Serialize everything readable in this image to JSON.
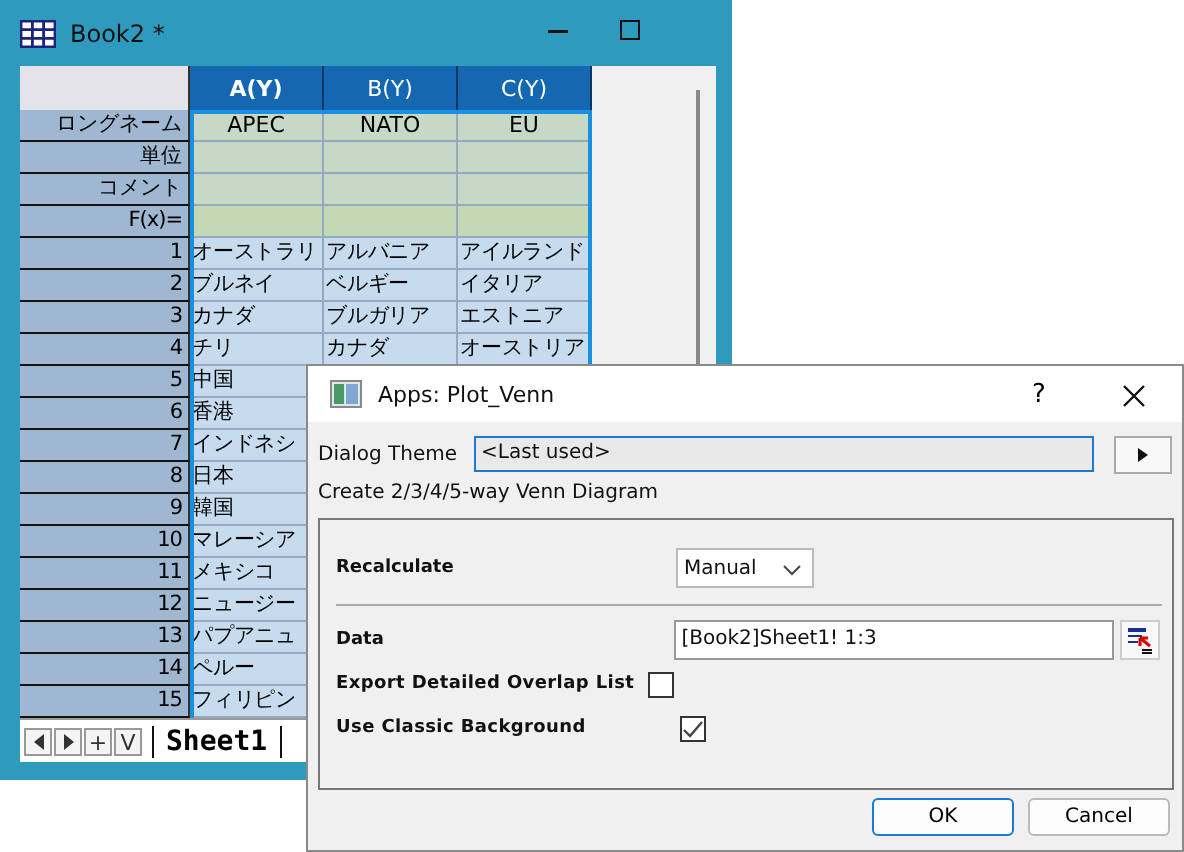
{
  "book": {
    "title": "Book2 *",
    "columns": [
      {
        "label": "A(Y)",
        "selected": true
      },
      {
        "label": "B(Y)",
        "selected": false
      },
      {
        "label": "C(Y)",
        "selected": false
      }
    ],
    "label_rows": [
      {
        "label": "ロングネーム",
        "cells": [
          "APEC",
          "NATO",
          "EU"
        ]
      },
      {
        "label": "単位",
        "cells": []
      },
      {
        "label": "コメント",
        "cells": []
      },
      {
        "label": "F(x)=",
        "cells": []
      }
    ],
    "rows": [
      {
        "label": "1",
        "cells": [
          "オーストラリ",
          "アルバニア",
          "アイルランド"
        ]
      },
      {
        "label": "2",
        "cells": [
          "ブルネイ",
          "ベルギー",
          "イタリア"
        ]
      },
      {
        "label": "3",
        "cells": [
          "カナダ",
          "ブルガリア",
          "エストニア"
        ]
      },
      {
        "label": "4",
        "cells": [
          "チリ",
          "カナダ",
          "オーストリア"
        ]
      },
      {
        "label": "5",
        "cells": [
          "中国"
        ]
      },
      {
        "label": "6",
        "cells": [
          "香港"
        ]
      },
      {
        "label": "7",
        "cells": [
          "インドネシ"
        ]
      },
      {
        "label": "8",
        "cells": [
          "日本"
        ]
      },
      {
        "label": "9",
        "cells": [
          "韓国"
        ]
      },
      {
        "label": "10",
        "cells": [
          "マレーシア"
        ]
      },
      {
        "label": "11",
        "cells": [
          "メキシコ"
        ]
      },
      {
        "label": "12",
        "cells": [
          "ニュージー"
        ]
      },
      {
        "label": "13",
        "cells": [
          "パプアニュ"
        ]
      },
      {
        "label": "14",
        "cells": [
          "ペルー"
        ]
      },
      {
        "label": "15",
        "cells": [
          "フィリピン"
        ]
      }
    ],
    "nav_buttons": [
      "+",
      "V"
    ],
    "sheet_tab": "Sheet1"
  },
  "dialog": {
    "title": "Apps: Plot_Venn",
    "help": "?",
    "theme_label": "Dialog Theme",
    "theme_value": "<Last used>",
    "description": "Create 2/3/4/5-way Venn Diagram",
    "recalculate": {
      "label": "Recalculate",
      "value": "Manual"
    },
    "data": {
      "label": "Data",
      "value": "[Book2]Sheet1! 1:3"
    },
    "options": [
      {
        "label": "Export Detailed Overlap List",
        "checked": false
      },
      {
        "label": "Use Classic Background",
        "checked": true
      }
    ],
    "buttons": [
      "OK",
      "Cancel"
    ]
  }
}
